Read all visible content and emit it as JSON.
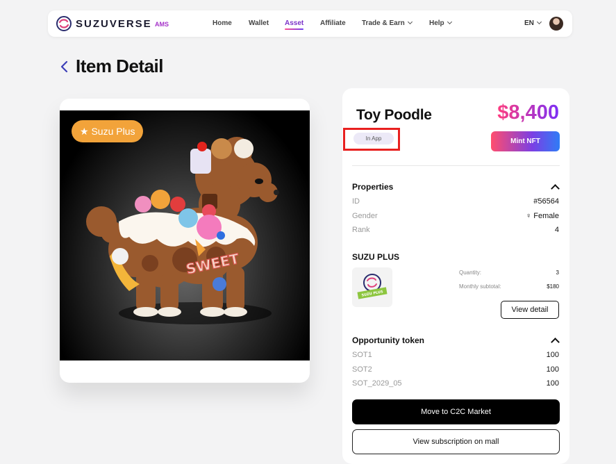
{
  "nav": {
    "brand": "SUZUVERSE",
    "brand_sub": "AMS",
    "links": [
      "Home",
      "Wallet",
      "Asset",
      "Affiliate",
      "Trade & Earn",
      "Help"
    ],
    "active": "Asset",
    "language": "EN"
  },
  "page": {
    "title": "Item Detail"
  },
  "image_card": {
    "badge": "★ Suzu Plus",
    "overlay_text": "SWEET"
  },
  "item": {
    "name": "Toy Poodle",
    "price": "$8,400",
    "status_tag": "In App",
    "mint_label": "Mint NFT"
  },
  "properties": {
    "title": "Properties",
    "rows": [
      {
        "label": "ID",
        "value": "#56564"
      },
      {
        "label": "Gender",
        "value": "♀ Female"
      },
      {
        "label": "Rank",
        "value": "4"
      }
    ]
  },
  "suzu_plus": {
    "title": "SUZU PLUS",
    "quantity_label": "Quantity:",
    "quantity_value": "3",
    "monthly_label": "Monthly subtotal:",
    "monthly_value": "$180",
    "view_detail": "View detail",
    "thumb_text": "SUZU PLUS"
  },
  "opportunity": {
    "title": "Opportunity token",
    "rows": [
      {
        "label": "SOT1",
        "value": "100"
      },
      {
        "label": "SOT2",
        "value": "100"
      },
      {
        "label": "SOT_2029_05",
        "value": "100"
      }
    ]
  },
  "actions": {
    "c2c": "Move to C2C Market",
    "mall": "View subscription on mall"
  },
  "colors": {
    "accent": "#7b33c9",
    "price_start": "#ff3d7f",
    "price_end": "#7b2ff7",
    "badge": "#f2a33a",
    "highlight": "#e8201f"
  }
}
